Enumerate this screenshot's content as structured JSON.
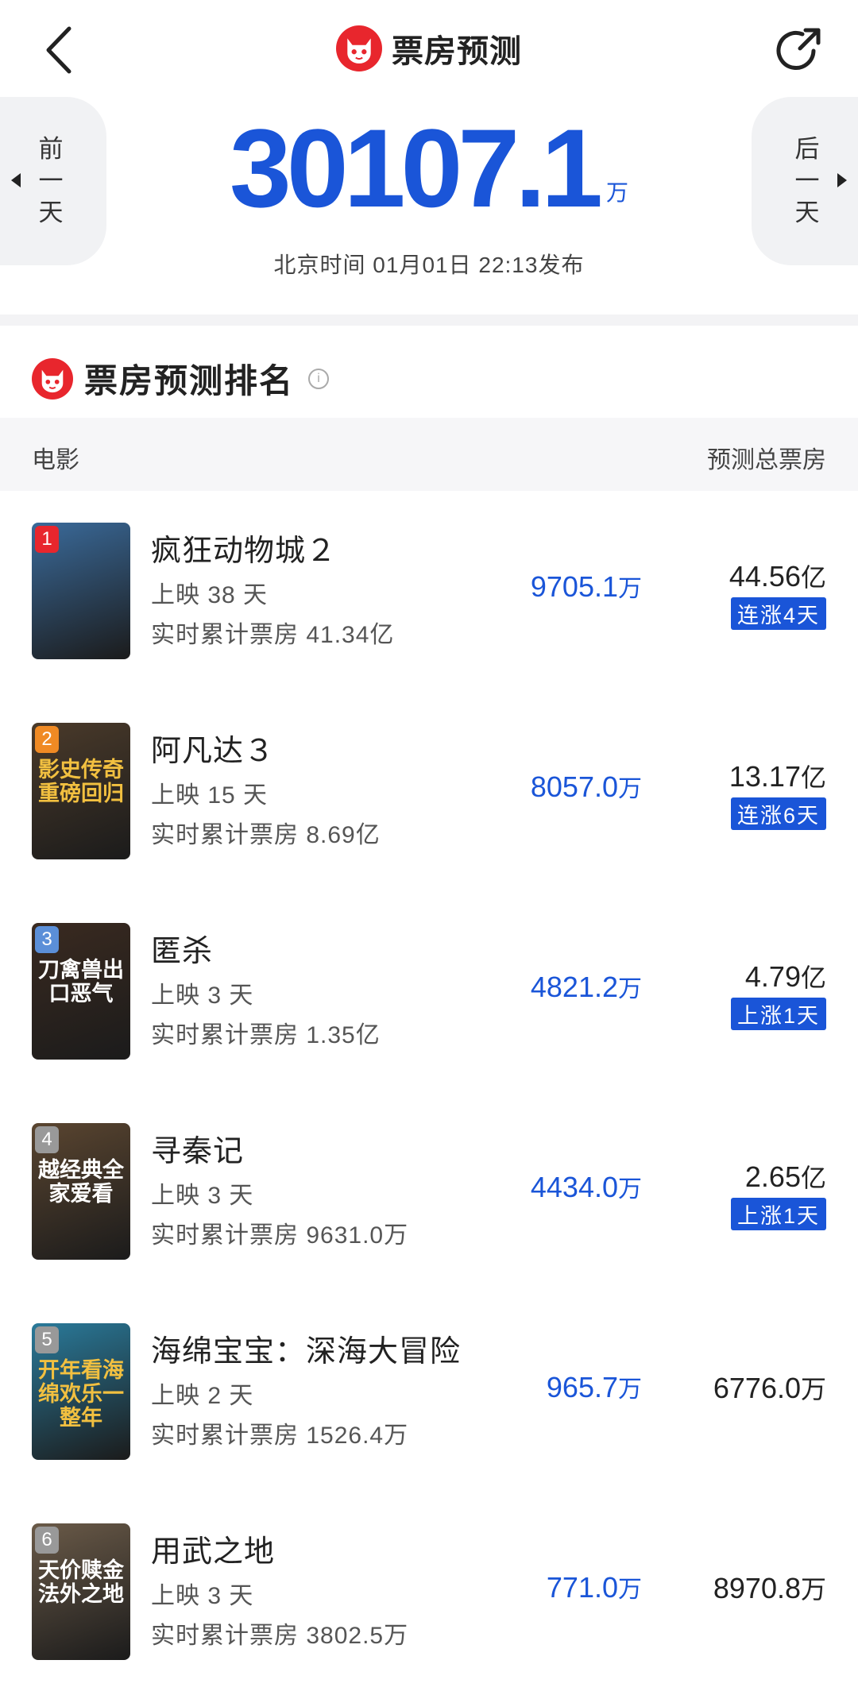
{
  "header": {
    "title": "票房预测"
  },
  "hero": {
    "prev_label": [
      "前",
      "一",
      "天"
    ],
    "next_label": [
      "后",
      "一",
      "天"
    ],
    "total": "30107.1",
    "unit": "万",
    "publish_time": "北京时间  01月01日  22:13发布"
  },
  "ranking": {
    "title": "票房预测排名",
    "col_movie": "电影",
    "col_total": "预测总票房"
  },
  "movies": [
    {
      "rank": "1",
      "name": "疯狂动物城２",
      "days": "上映 38 天",
      "cumulative": "实时累计票房 41.34亿",
      "today": "9705.1",
      "today_unit": "万",
      "pred": "44.56",
      "pred_unit": "亿",
      "badge": "连涨4天",
      "poster_text": "",
      "poster_color": "#3a6a9a",
      "rank_color": "#e8262d"
    },
    {
      "rank": "2",
      "name": "阿凡达３",
      "days": "上映 15 天",
      "cumulative": "实时累计票房 8.69亿",
      "today": "8057.0",
      "today_unit": "万",
      "pred": "13.17",
      "pred_unit": "亿",
      "badge": "连涨6天",
      "poster_text": "影史传奇重磅回归",
      "poster_color": "#4a3a2a",
      "rank_color": "#f08a24"
    },
    {
      "rank": "3",
      "name": "匿杀",
      "days": "上映 3 天",
      "cumulative": "实时累计票房 1.35亿",
      "today": "4821.2",
      "today_unit": "万",
      "pred": "4.79",
      "pred_unit": "亿",
      "badge": "上涨1天",
      "poster_text": "刀禽兽出口恶气",
      "poster_color": "#3a2a20",
      "rank_color": "#5b8fd8"
    },
    {
      "rank": "4",
      "name": "寻秦记",
      "days": "上映 3 天",
      "cumulative": "实时累计票房 9631.0万",
      "today": "4434.0",
      "today_unit": "万",
      "pred": "2.65",
      "pred_unit": "亿",
      "badge": "上涨1天",
      "poster_text": "越经典全家爱看",
      "poster_color": "#5a4530",
      "rank_color": "#999999"
    },
    {
      "rank": "5",
      "name": "海绵宝宝：深海大冒险",
      "days": "上映 2 天",
      "cumulative": "实时累计票房 1526.4万",
      "today": "965.7",
      "today_unit": "万",
      "pred": "6776.0",
      "pred_unit": "万",
      "badge": "",
      "poster_text": "开年看海绵欢乐一整年",
      "poster_color": "#2a7a9a",
      "rank_color": "#999999"
    },
    {
      "rank": "6",
      "name": "用武之地",
      "days": "上映 3 天",
      "cumulative": "实时累计票房 3802.5万",
      "today": "771.0",
      "today_unit": "万",
      "pred": "8970.8",
      "pred_unit": "万",
      "badge": "",
      "poster_text": "天价赎金 法外之地",
      "poster_color": "#6a5a48",
      "rank_color": "#999999"
    }
  ],
  "colors": {
    "accent_blue": "#1a55d8",
    "brand_red": "#e8262d"
  }
}
